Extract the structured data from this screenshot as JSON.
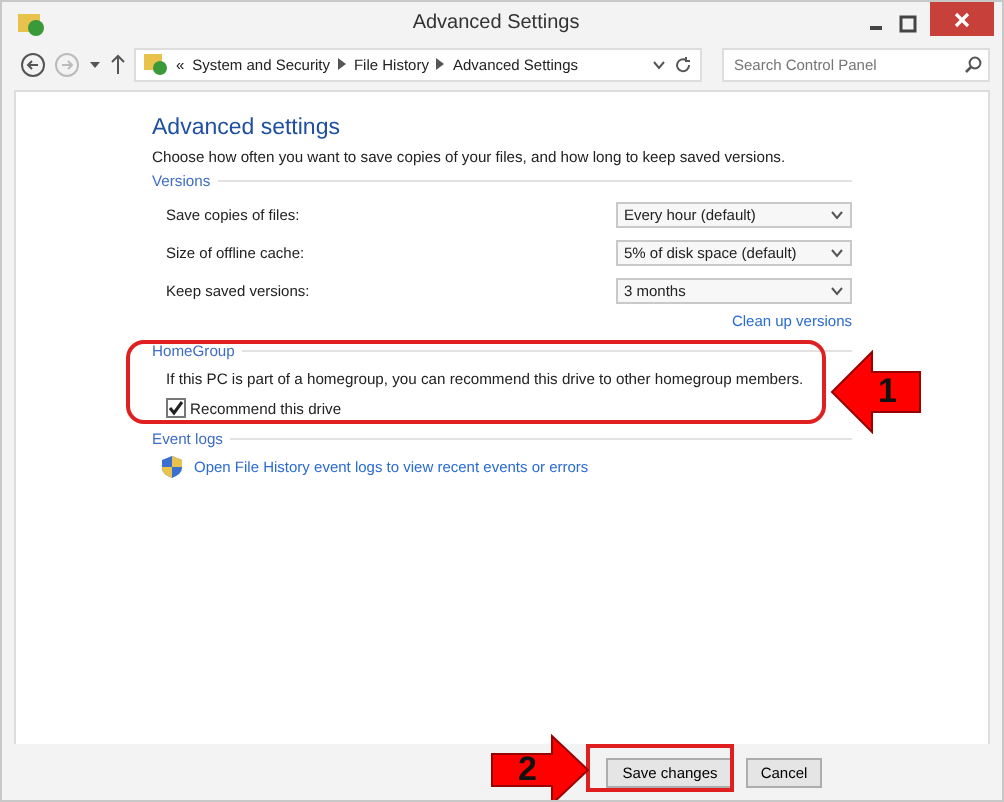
{
  "window": {
    "title": "Advanced Settings"
  },
  "breadcrumb": {
    "overflow": "«",
    "items": [
      "System and Security",
      "File History",
      "Advanced Settings"
    ]
  },
  "search": {
    "placeholder": "Search Control Panel"
  },
  "heading": "Advanced settings",
  "description": "Choose how often you want to save copies of your files, and how long to keep saved versions.",
  "versions": {
    "title": "Versions",
    "settings": [
      {
        "label": "Save copies of files:",
        "value": "Every hour (default)"
      },
      {
        "label": "Size of offline cache:",
        "value": "5% of disk space (default)"
      },
      {
        "label": "Keep saved versions:",
        "value": "3 months"
      }
    ],
    "link": "Clean up versions"
  },
  "homegroup": {
    "title": "HomeGroup",
    "text": "If this PC is part of a homegroup, you can recommend this drive to other homegroup members.",
    "checkbox": {
      "label": "Recommend this drive",
      "checked": true
    }
  },
  "event_logs": {
    "title": "Event logs",
    "link": "Open File History event logs to view recent events or errors"
  },
  "buttons": [
    "Save changes",
    "Cancel"
  ],
  "annotations": [
    "1",
    "2"
  ]
}
